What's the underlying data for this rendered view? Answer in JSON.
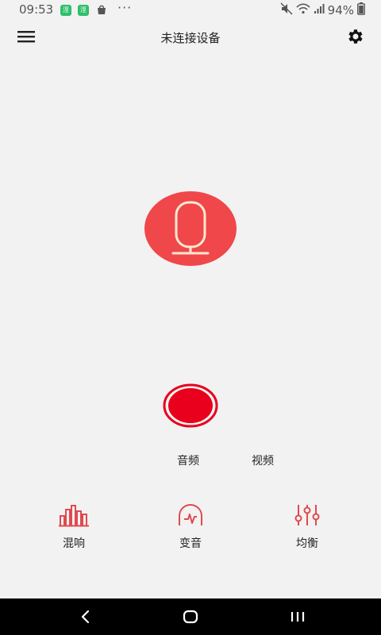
{
  "status_bar": {
    "time": "09:53",
    "app_badge_1": "淫",
    "app_badge_2": "淫",
    "more": "···",
    "battery": "94%"
  },
  "header": {
    "title": "未连接设备"
  },
  "mode_tabs": [
    {
      "label": "音频"
    },
    {
      "label": "视频"
    }
  ],
  "tools": [
    {
      "label": "混响",
      "icon": "reverb-bars-icon"
    },
    {
      "label": "变音",
      "icon": "voice-change-icon"
    },
    {
      "label": "均衡",
      "icon": "equalizer-icon"
    }
  ],
  "colors": {
    "accent": "#f0474b",
    "record": "#e8001c",
    "background": "#f2f2f2",
    "navbar": "#000000"
  }
}
